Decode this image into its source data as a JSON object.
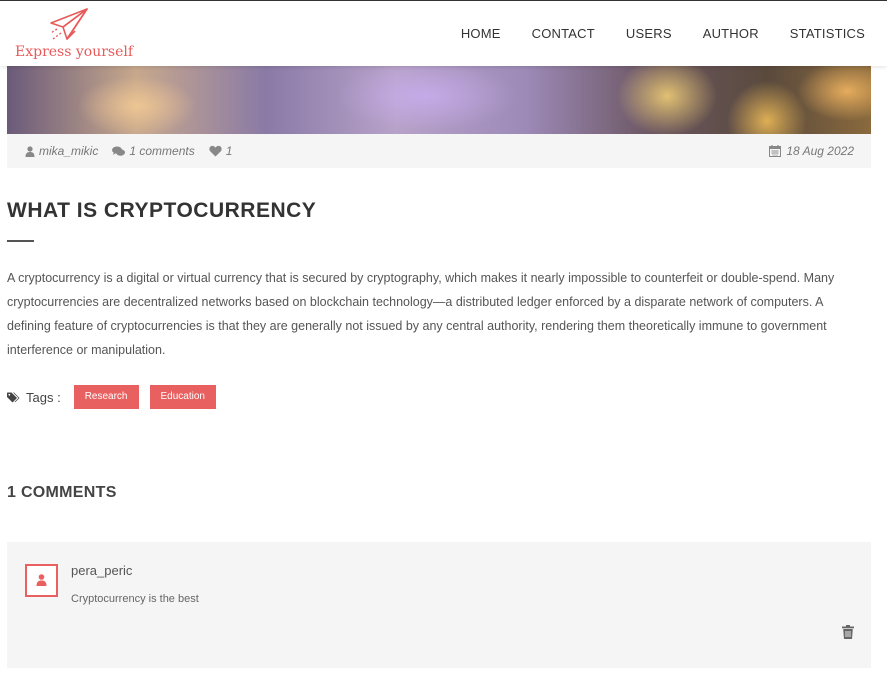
{
  "header": {
    "logo_text": "Express yourself",
    "nav": [
      "HOME",
      "CONTACT",
      "USERS",
      "AUTHOR",
      "STATISTICS"
    ]
  },
  "post": {
    "author": "mika_mikic",
    "comments_count": "1 comments",
    "likes": "1",
    "date": "18 Aug 2022",
    "title": "WHAT IS CRYPTOCURRENCY",
    "body": "A cryptocurrency is a digital or virtual currency that is secured by cryptography, which makes it nearly impossible to counterfeit or double-spend. Many cryptocurrencies are decentralized networks based on blockchain technology—a distributed ledger enforced by a disparate network of computers. A defining feature of cryptocurrencies is that they are generally not issued by any central authority, rendering them theoretically immune to government interference or manipulation.",
    "tags_label": "Tags :",
    "tags": [
      "Research",
      "Education"
    ]
  },
  "comments": {
    "heading": "1 COMMENTS",
    "items": [
      {
        "user": "pera_peric",
        "text": "Cryptocurrency is the best"
      }
    ]
  },
  "colors": {
    "accent": "#e86060",
    "text": "#555555",
    "meta_bg": "#f5f5f5"
  },
  "icons": [
    "paper-plane-icon",
    "user-icon",
    "comments-icon",
    "heart-icon",
    "calendar-icon",
    "tags-icon",
    "trash-icon"
  ]
}
